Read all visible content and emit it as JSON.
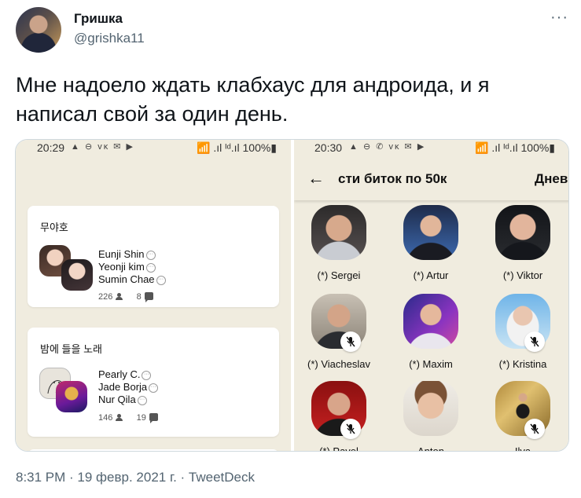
{
  "author": {
    "name": "Гришка",
    "handle": "@grishka11"
  },
  "tweet": {
    "line1": "Мне надоело ждать клабхаус для андроида, и я",
    "line2": "написал свой за один день."
  },
  "left_screen": {
    "status": {
      "time": "20:29",
      "icons": "▲ ⊖ ᴠᴋ ✉ ▶",
      "right": "📶 .ıl ᴵᵈ.ıl 100%▮"
    },
    "rooms": [
      {
        "title": "무야호",
        "speakers": [
          "Eunji Shin",
          "Yeonji kim",
          "Sumin Chae"
        ],
        "listeners": "226",
        "speaker_count": "8"
      },
      {
        "title": "밤에 들을 노래",
        "speakers": [
          "Pearly C.",
          "Jade Borja",
          "Nur Qila"
        ],
        "listeners": "146",
        "speaker_count": "19"
      }
    ]
  },
  "right_screen": {
    "status": {
      "time": "20:30",
      "icons": "▲ ⊖ ✆ ᴠᴋ ✉ ▶",
      "right": "📶 .ıl ᴵᵈ.ıl 100%▮"
    },
    "room_name": "сти биток по 50к",
    "room_tab": "Днев",
    "participants": [
      {
        "name": "(*) Sergei",
        "muted": false
      },
      {
        "name": "(*) Artur",
        "muted": false
      },
      {
        "name": "(*) Viktor",
        "muted": false
      },
      {
        "name": "(*) Viacheslav",
        "muted": true
      },
      {
        "name": "(*) Maxim",
        "muted": false
      },
      {
        "name": "(*) Kristina",
        "muted": true
      },
      {
        "name": "(*) Pavel",
        "muted": true
      },
      {
        "name": "Anton",
        "muted": false
      },
      {
        "name": "Ilya",
        "muted": true
      }
    ]
  },
  "meta": "8:31 PM · 19 февр. 2021 г. · TweetDeck",
  "more_label": "···"
}
